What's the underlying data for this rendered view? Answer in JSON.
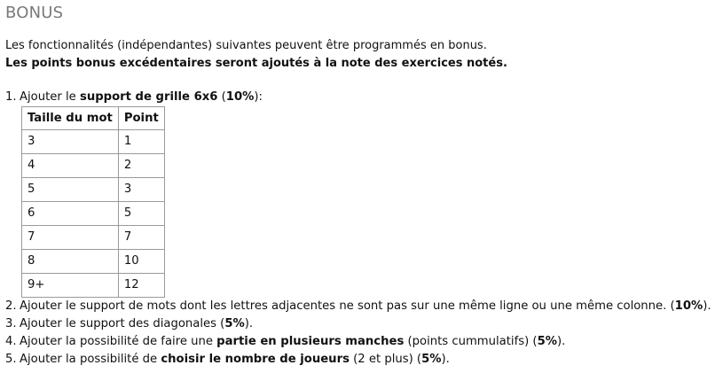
{
  "heading": "BONUS",
  "intro": {
    "line1": "Les fonctionnalités (indépendantes) suivantes peuvent être programmés en bonus.",
    "line2": "Les points bonus excédentaires seront ajoutés à la note des exercices notés."
  },
  "items": [
    {
      "number": "1.",
      "text1": "Ajouter le ",
      "bold1": "support de grille 6x6",
      "text2": " (",
      "bold2": "10%",
      "text3": "):"
    },
    {
      "number": "2.",
      "text1": "Ajouter le support de mots dont les lettres adjacentes ne sont pas sur une même ligne ou une même colonne. (",
      "bold1": "10%",
      "text2": ")."
    },
    {
      "number": "3.",
      "text1": "Ajouter le support des diagonales (",
      "bold1": "5%",
      "text2": ")."
    },
    {
      "number": "4.",
      "text1": "Ajouter la possibilité de faire une ",
      "bold1": "partie en plusieurs manches",
      "text2": " (points cummulatifs) (",
      "bold2": "5%",
      "text3": ")."
    },
    {
      "number": "5.",
      "text1": "Ajouter la possibilité de ",
      "bold1": "choisir le nombre de joueurs",
      "text2": " (2 et plus) (",
      "bold2": "5%",
      "text3": ")."
    }
  ],
  "table": {
    "headers": [
      "Taille du mot",
      "Point"
    ],
    "rows": [
      [
        "3",
        "1"
      ],
      [
        "4",
        "2"
      ],
      [
        "5",
        "3"
      ],
      [
        "6",
        "5"
      ],
      [
        "7",
        "7"
      ],
      [
        "8",
        "10"
      ],
      [
        "9+",
        "12"
      ]
    ]
  }
}
